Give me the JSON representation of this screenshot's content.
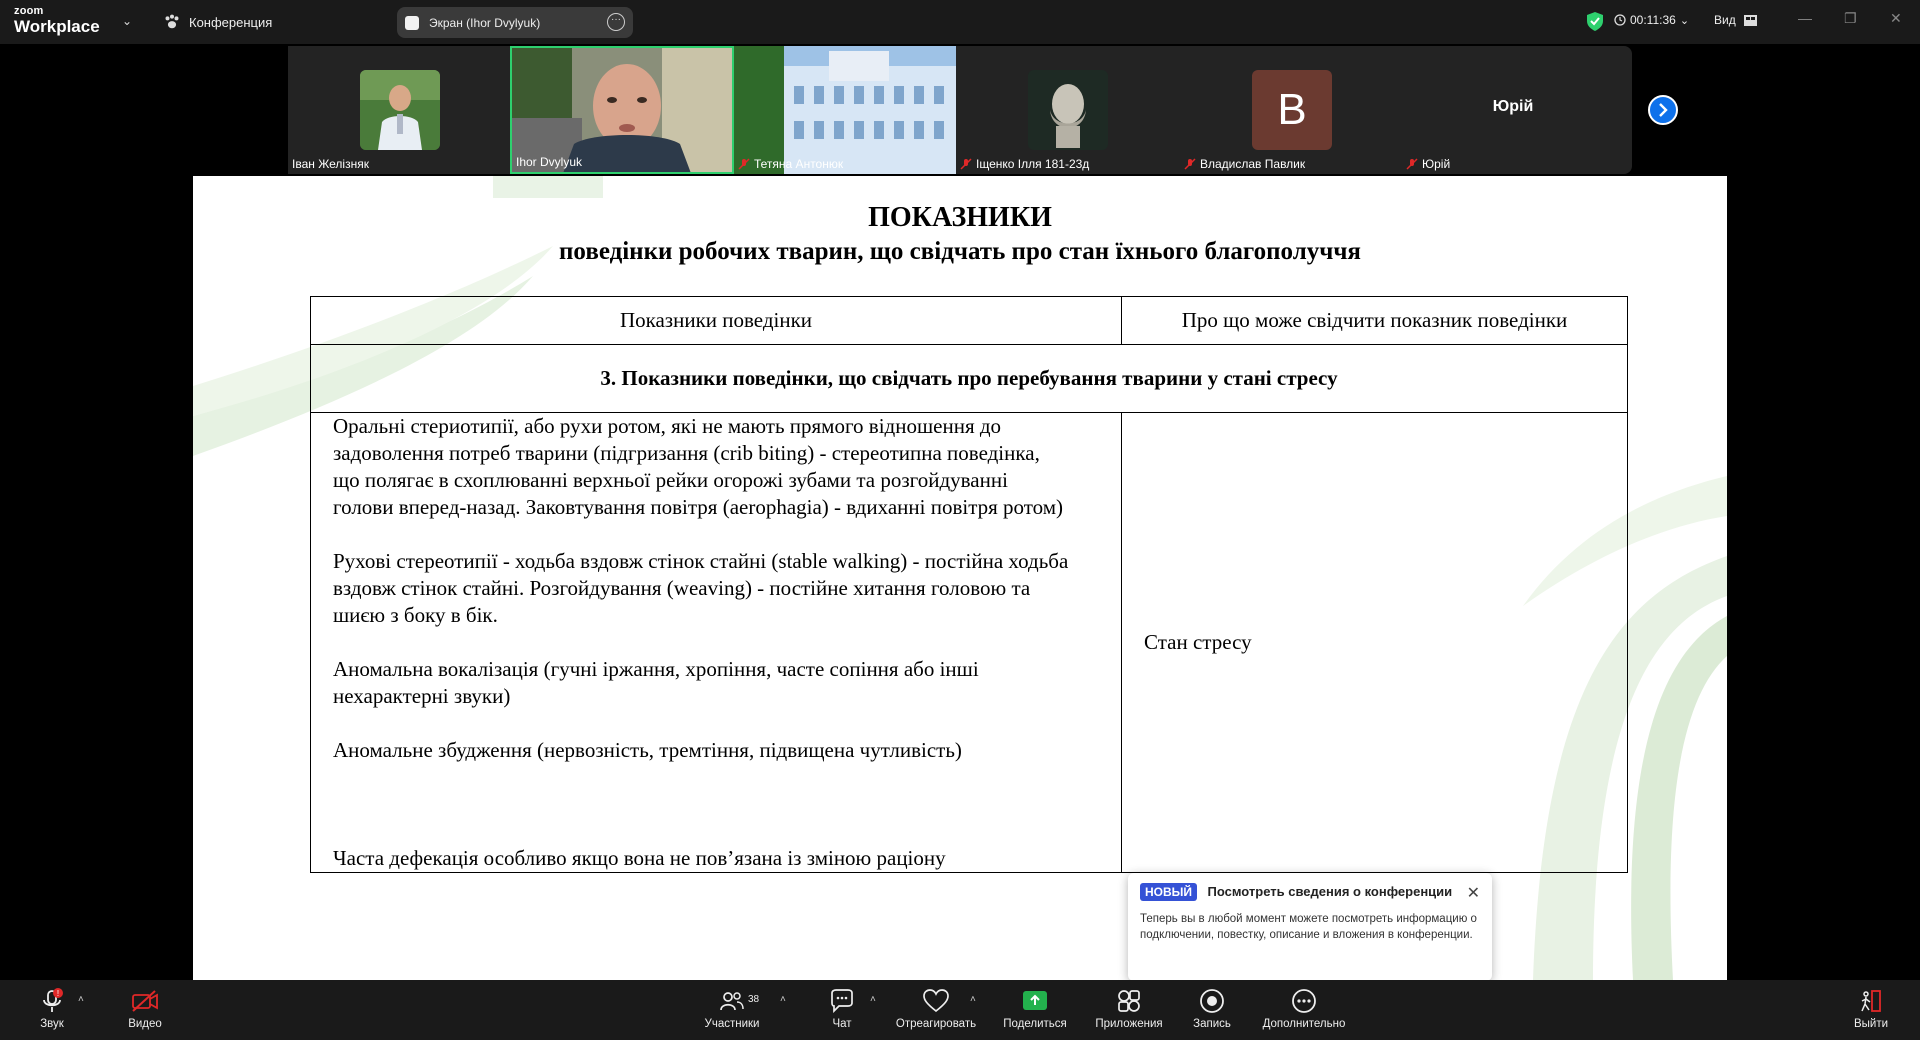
{
  "app": {
    "brand_small": "zoom",
    "brand_large": "Workplace"
  },
  "topbar": {
    "conference_label": "Конференция",
    "share_label": "Экран (Ihor Dvylyuk)",
    "timer": "00:11:36",
    "view_label": "Вид"
  },
  "participants": [
    {
      "name": "Іван Желізняк"
    },
    {
      "name": "Ihor Dvylyuk"
    },
    {
      "name": "Тетяна Антонюк"
    },
    {
      "name": "Іщенко Ілля 181-23д"
    },
    {
      "name": "Владислав Павлик",
      "initial": "В"
    },
    {
      "name": "Юрій",
      "display": "Юрій"
    }
  ],
  "slide": {
    "title": "ПОКАЗНИКИ",
    "subtitle": "поведінки робочих тварин, що свідчать про стан їхнього благополуччя",
    "col1_header": "Показники поведінки",
    "col2_header": "Про що може свідчити показник поведінки",
    "section": "3. Показники поведінки, що свідчать про перебування тварини у стані стресу",
    "lines1": [
      "Оральні стериотипії, або рухи ротом, які не мають прямого відношення до",
      "задоволення потреб тварини (підгризання (crib biting) - стереотипна поведінка,",
      "що полягає в схоплюванні верхньої рейки огорожі зубами та розгойдуванні",
      "голови вперед-назад. Заковтування повітря (aerophagia) - вдиханні повітря ротом)"
    ],
    "lines2": [
      "Рухові стереотипії - ходьба вздовж стінок стайні (stable walking) - постійна ходьба",
      "вздовж стінок стайні. Розгойдування (weaving) - постійне хитання головою та",
      "шиєю з боку в бік."
    ],
    "lines3": [
      "Аномальна вокалізація (гучні іржання, хропіння, часте сопіння або інші",
      "нехарактерні звуки)"
    ],
    "line4": "Аномальне збудження (нервозність, тремтіння, підвищена чутливість)",
    "line5": "Часта дефекація особливо якщо вона не пов’язана із зміною раціону",
    "right_value": "Стан стресу"
  },
  "toast": {
    "badge": "НОВЫЙ",
    "title": "Посмотреть сведения о конференции",
    "body": "Теперь вы в любой момент можете посмотреть информацию о подключении, повестку, описание и вложения в конференции."
  },
  "toolbar": {
    "audio": "Звук",
    "video": "Видео",
    "participants": "Участники",
    "participants_count": "38",
    "chat": "Чат",
    "react": "Отреагировать",
    "share": "Поделиться",
    "apps": "Приложения",
    "record": "Запись",
    "more": "Дополнительно",
    "leave": "Выйти"
  },
  "colors": {
    "accent_green": "#2ed06e",
    "share_green": "#23b14d",
    "badge_blue": "#3552d6",
    "arrow_blue": "#0e71eb",
    "alert_red": "#e02828"
  }
}
